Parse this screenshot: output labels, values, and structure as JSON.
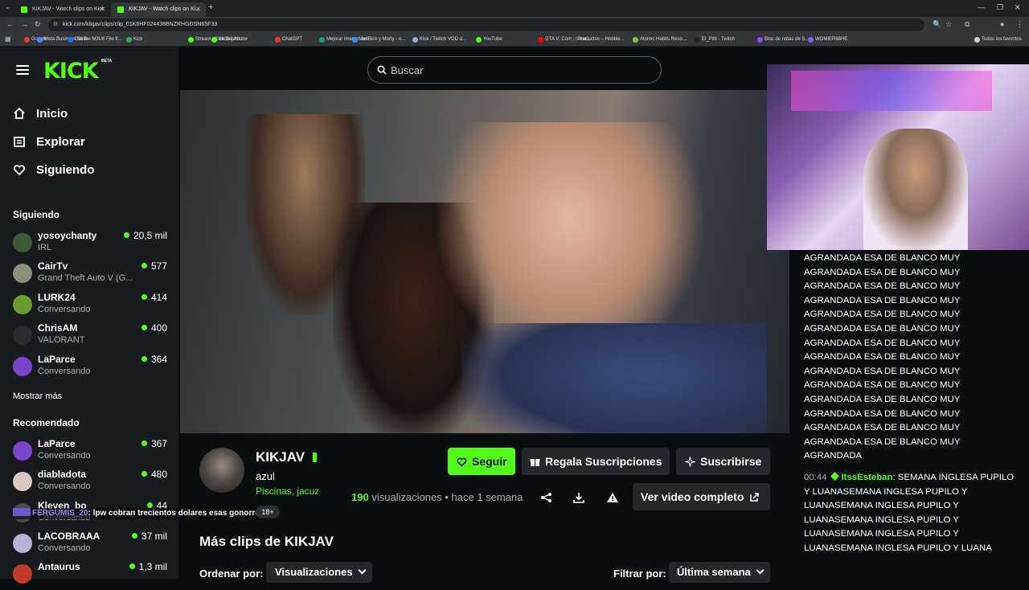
{
  "browser": {
    "tabs": [
      {
        "title": "KIKJAV - Watch clips on Kick"
      },
      {
        "title": "KIKJAV - Watch clips on Ki..."
      }
    ],
    "url": "kick.com/kikjav/clips/clip_01K6HF024438BNZRHGDSN65F33",
    "bookmarks": [
      "Google",
      "Meta Business Suite",
      "Get the M3U8 File fr...",
      "Kick",
      "Stream - Kick Dashb...",
      "Inicio | Adobe",
      "ChatGPT",
      "Mejorar imagen onli...",
      "Ver Rick y Morty - o...",
      "Kick / Twitch VOD d...",
      "YouTube",
      "GTA V: Cómo crear...",
      "Productos – Hobbie...",
      "Atomic Habits Reso...",
      "El_Pitti - Twitch",
      "Bloc de notas de S...",
      "WOMIER68HE",
      "Todos los favoritos"
    ]
  },
  "site": {
    "logo": "KICK",
    "logo_badge": "BETA",
    "search": {
      "placeholder": "Buscar"
    },
    "nav": [
      {
        "label": "Inicio",
        "icon": "home-icon"
      },
      {
        "label": "Explorar",
        "icon": "compass-icon"
      },
      {
        "label": "Siguiendo",
        "icon": "heart-icon"
      }
    ],
    "following_heading": "Siguiendo",
    "following": [
      {
        "name": "yosoychanty",
        "category": "IRL",
        "viewers": "20,5 mil"
      },
      {
        "name": "CairTv",
        "category": "Grand Theft Auto V (G...",
        "viewers": "577"
      },
      {
        "name": "LURK24",
        "category": "Conversando",
        "viewers": "414"
      },
      {
        "name": "ChrisAM",
        "category": "VALORANT",
        "viewers": "400"
      },
      {
        "name": "LaParce",
        "category": "Conversando",
        "viewers": "364"
      }
    ],
    "show_more": "Mostrar más",
    "recommended_heading": "Recomendado",
    "recommended": [
      {
        "name": "LaParce",
        "category": "Conversando",
        "viewers": "367"
      },
      {
        "name": "diabladota",
        "category": "Conversando",
        "viewers": "480"
      },
      {
        "name": "Kleven_bo",
        "category": "Conversando",
        "viewers": "44"
      },
      {
        "name": "LACOBRAAA",
        "category": "Conversando",
        "viewers": "37 mil"
      },
      {
        "name": "Antaurus",
        "category": "",
        "viewers": "1,3 mil"
      }
    ],
    "clip": {
      "channel": "KIKJAV",
      "title": "azul",
      "tags": "Piscinas, jacuzzis",
      "age_badge": "18+",
      "views_number": "190",
      "views_label": "visualizaciones",
      "time_ago": "• hace 1 semana",
      "follow_label": "Seguir",
      "gift_label": "Regala Suscripciones",
      "subscribe_label": "Suscribirse",
      "full_video_label": "Ver video completo"
    },
    "more_clips_heading": "Más clips de KIKJAV",
    "sort_label": "Ordenar por:",
    "sort_value": "Visualizaciones",
    "filter_label": "Filtrar por:",
    "filter_value": "Última semana"
  },
  "overlay_chat": {
    "user": "FERGUMIS_20",
    "message": ": lpw cobran trecientos dolares esas gonorreas"
  },
  "chat": {
    "repeated_lines": [
      "AGRANDADA ESA DE BLANCO MUY",
      "AGRANDADA ESA DE BLANCO MUY",
      "AGRANDADA ESA DE BLANCO MUY",
      "AGRANDADA ESA DE BLANCO MUY",
      "AGRANDADA ESA DE BLANCO MUY",
      "AGRANDADA ESA DE BLANCO MUY",
      "AGRANDADA ESA DE BLANCO MUY",
      "AGRANDADA ESA DE BLANCO MUY",
      "AGRANDADA ESA DE BLANCO MUY",
      "AGRANDADA ESA DE BLANCO MUY",
      "AGRANDADA ESA DE BLANCO MUY",
      "AGRANDADA ESA DE BLANCO MUY",
      "AGRANDADA ESA DE BLANCO MUY",
      "AGRANDADA ESA DE BLANCO MUY",
      "AGRANDADA"
    ],
    "message2": {
      "time": "00:44",
      "user": "ItssEsteban",
      "text": ": SEMANA INGLESA PUPILO Y LUANASEMANA INGLESA PUPILO Y LUANASEMANA INGLESA PUPILO Y LUANASEMANA INGLESA PUPILO Y LUANASEMANA INGLESA PUPILO Y LUANASEMANA INGLESA PUPILO Y LUANA"
    }
  },
  "colors": {
    "accent": "#53fc18",
    "sidebar": "#191b1f",
    "background": "#0b0e0f",
    "button": "#24272c"
  }
}
